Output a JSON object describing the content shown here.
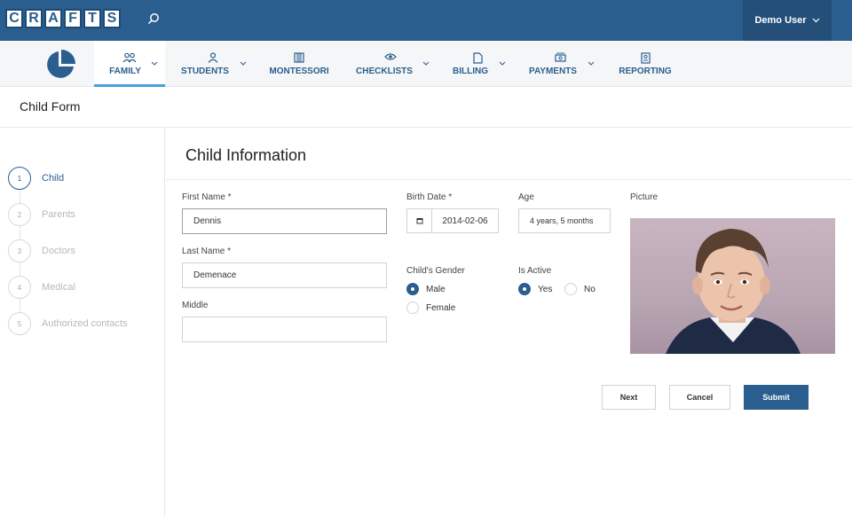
{
  "app": {
    "logo_letters": [
      "C",
      "R",
      "A",
      "F",
      "T",
      "S"
    ],
    "user_name": "Demo User"
  },
  "nav": {
    "items": [
      {
        "label": "FAMILY",
        "icon": "family-icon"
      },
      {
        "label": "STUDENTS",
        "icon": "student-icon"
      },
      {
        "label": "MONTESSORI",
        "icon": "montessori-icon"
      },
      {
        "label": "CHECKLISTS",
        "icon": "eye-icon"
      },
      {
        "label": "BILLING",
        "icon": "document-icon"
      },
      {
        "label": "PAYMENTS",
        "icon": "cash-icon"
      },
      {
        "label": "REPORTING",
        "icon": "report-icon"
      }
    ]
  },
  "page": {
    "title": "Child Form",
    "section_title": "Child Information"
  },
  "steps": [
    {
      "num": "1",
      "label": "Child"
    },
    {
      "num": "2",
      "label": "Parents"
    },
    {
      "num": "3",
      "label": "Doctors"
    },
    {
      "num": "4",
      "label": "Medical"
    },
    {
      "num": "5",
      "label": "Authorized contacts"
    }
  ],
  "form": {
    "first_name_label": "First Name *",
    "first_name_value": "Dennis",
    "last_name_label": "Last Name *",
    "last_name_value": "Demenace",
    "middle_label": "Middle",
    "middle_value": "",
    "birth_date_label": "Birth Date *",
    "birth_date_value": "2014-02-06",
    "age_label": "Age",
    "age_value": "4 years, 5 months",
    "picture_label": "Picture",
    "gender_label": "Child's Gender",
    "gender_male": "Male",
    "gender_female": "Female",
    "active_label": "Is Active",
    "active_yes": "Yes",
    "active_no": "No"
  },
  "buttons": {
    "next": "Next",
    "cancel": "Cancel",
    "submit": "Submit"
  },
  "colors": {
    "brand": "#2a5e8e",
    "accent": "#4a9fd6"
  }
}
